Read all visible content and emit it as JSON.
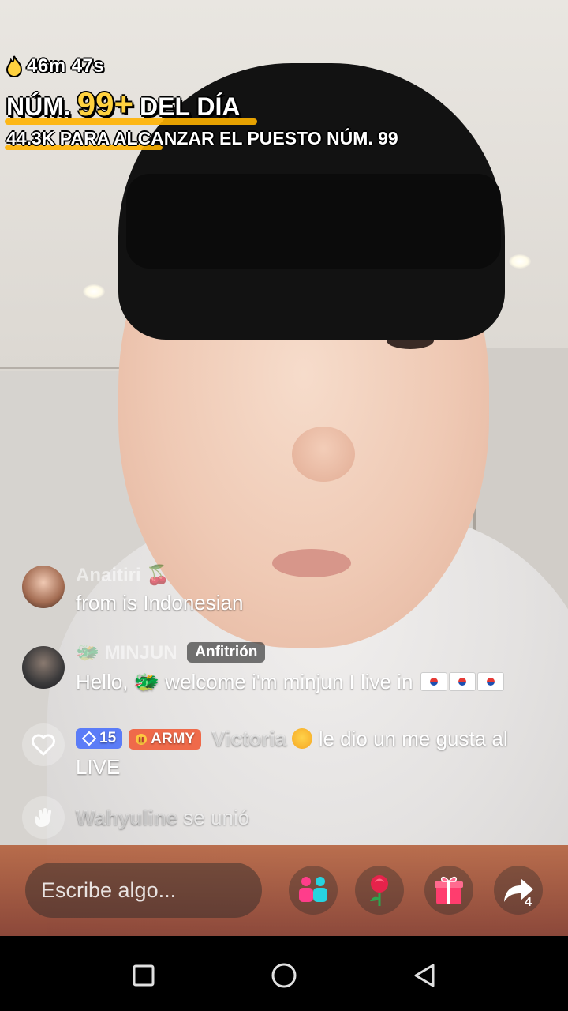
{
  "stream": {
    "duration": "46m 47s",
    "rank_label": "NÚM.",
    "rank_number": "99+",
    "rank_suffix": "DEL DÍA",
    "progress_text": "44.3K PARA ALCANZAR EL PUESTO NÚM. 99"
  },
  "chat": {
    "messages": [
      {
        "user": "Anaitiri 🍒",
        "text": "from is Indonesian"
      },
      {
        "user": "MINJUN",
        "badge": "Anfitrión",
        "text": "Hello, 🐲 welcome i'm minjun I live in",
        "flags": [
          "🇰🇷",
          "🇰🇷",
          "🇰🇷"
        ],
        "emoji": "🐲"
      },
      {
        "level": "15",
        "fan_badge": "ARMY",
        "user": "Victoria",
        "text": "le dio un me gusta al",
        "text2": "LIVE"
      },
      {
        "user": "Wahyuline",
        "text": "se unió"
      }
    ]
  },
  "bottom_bar": {
    "input_placeholder": "Escribe algo...",
    "share_count": "4"
  },
  "icons": {
    "flame": "flame-icon",
    "like": "heart-icon",
    "join": "wave-hand-icon",
    "guests": "multi-guest-icon",
    "rose": "rose-icon",
    "gift": "gift-icon",
    "share": "share-arrow-icon"
  },
  "colors": {
    "rank_yellow": "#ffd23f",
    "level_badge": "#5b7cf7",
    "army_badge": "#ef6a4a",
    "gift_pink": "#ff3d6e"
  }
}
